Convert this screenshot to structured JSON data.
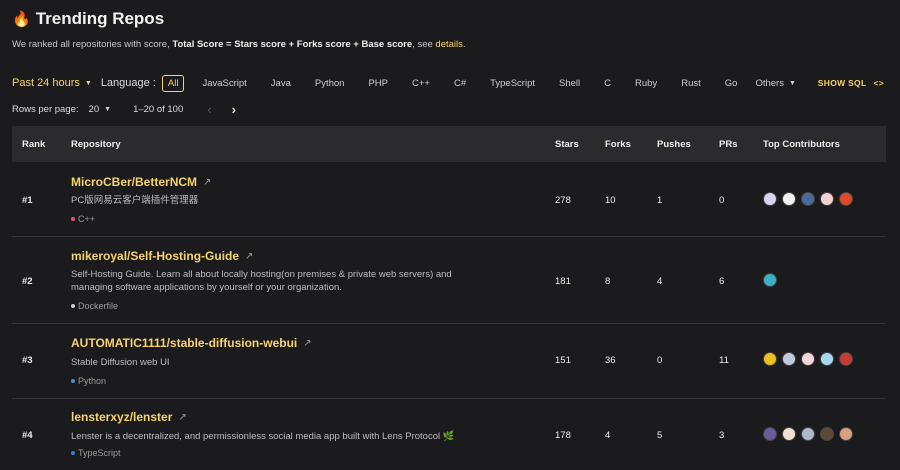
{
  "header": {
    "icon": "fire-icon",
    "title": "Trending Repos",
    "subtitle_prefix": "We ranked all repositories with score, ",
    "subtitle_formula": "Total Score = Stars score + Forks score + Base score",
    "subtitle_mid": ", see ",
    "subtitle_link": "details",
    "subtitle_suffix": "."
  },
  "filters": {
    "period": "Past 24 hours",
    "language_label": "Language :",
    "languages": [
      "All",
      "JavaScript",
      "Java",
      "Python",
      "PHP",
      "C++",
      "C#",
      "TypeScript",
      "Shell",
      "C",
      "Ruby",
      "Rust",
      "Go"
    ],
    "active_language": "All",
    "others_label": "Others",
    "show_sql_label": "SHOW SQL",
    "show_sql_icon": "code-icon"
  },
  "pagination": {
    "rows_label": "Rows per page:",
    "rows_value": "20",
    "range": "1–20 of 100"
  },
  "table": {
    "columns": {
      "rank": "Rank",
      "repository": "Repository",
      "stars": "Stars",
      "forks": "Forks",
      "pushes": "Pushes",
      "prs": "PRs",
      "contributors": "Top Contributors"
    },
    "rows": [
      {
        "rank": "#1",
        "name": "MicroCBer/BetterNCM",
        "desc1": "PC版网易云客户端插件管理器",
        "desc2": "",
        "language": "C++",
        "lang_color": "#e0557d",
        "stars": "278",
        "forks": "10",
        "pushes": "1",
        "prs": "0",
        "avatars": [
          "#d9d2f0",
          "#f2f2f2",
          "#4a6a9a",
          "#f5d0d0",
          "#e04a2a"
        ]
      },
      {
        "rank": "#2",
        "name": "mikeroyal/Self-Hosting-Guide",
        "desc1": "Self-Hosting Guide. Learn all about locally hosting(on premises & private web servers) and",
        "desc2": "managing software applications by yourself or your organization.",
        "language": "Dockerfile",
        "lang_color": "#cccccc",
        "stars": "181",
        "forks": "8",
        "pushes": "4",
        "prs": "6",
        "avatars": [
          "#3bb0c9"
        ]
      },
      {
        "rank": "#3",
        "name": "AUTOMATIC1111/stable-diffusion-webui",
        "desc1": "Stable Diffusion web UI",
        "desc2": "",
        "language": "Python",
        "lang_color": "#4a8ad4",
        "stars": "151",
        "forks": "36",
        "pushes": "0",
        "prs": "11",
        "avatars": [
          "#e8c020",
          "#c0c8e0",
          "#f5d6d6",
          "#a8d8f0",
          "#c83a3a"
        ]
      },
      {
        "rank": "#4",
        "name": "lensterxyz/lenster",
        "desc1": "Lenster is a decentralized, and permissionless social media app built with Lens Protocol 🌿",
        "desc2": "",
        "language": "TypeScript",
        "lang_color": "#3a7bd5",
        "stars": "178",
        "forks": "4",
        "pushes": "5",
        "prs": "3",
        "avatars": [
          "#6a5a9a",
          "#f0e0d0",
          "#b0b8c8",
          "#5a4a3a",
          "#d8a080"
        ]
      }
    ]
  }
}
